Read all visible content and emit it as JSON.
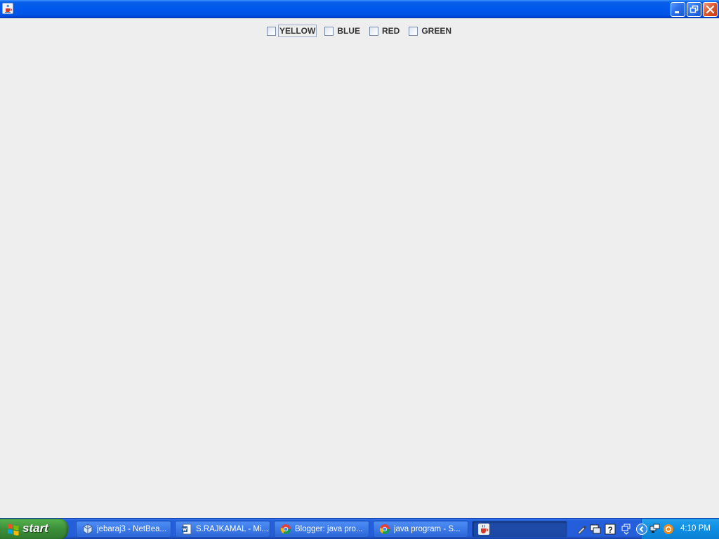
{
  "window": {
    "title": "",
    "icon": "java-cup-icon",
    "controls": [
      "minimize-icon",
      "restore-icon",
      "close-icon"
    ]
  },
  "checkboxes": [
    {
      "label": "YELLOW",
      "checked": false,
      "focused": true
    },
    {
      "label": "BLUE",
      "checked": false,
      "focused": false
    },
    {
      "label": "RED",
      "checked": false,
      "focused": false
    },
    {
      "label": "GREEN",
      "checked": false,
      "focused": false
    }
  ],
  "taskbar": {
    "start_label": "start",
    "tasks": [
      {
        "label": "jebaraj3 - NetBea...",
        "icon": "netbeans-cube-icon",
        "active": false
      },
      {
        "label": "S.RAJKAMAL - Mi...",
        "icon": "word-document-icon",
        "active": false
      },
      {
        "label": "Blogger: java pro...",
        "icon": "chrome-icon",
        "active": false
      },
      {
        "label": "java program - S...",
        "icon": "chrome-icon",
        "active": false
      },
      {
        "label": "",
        "icon": "java-cup-icon",
        "active": true
      }
    ],
    "quick_icons": [
      "pen-tool-icon",
      "network-monitor-icon",
      "help-icon",
      "windows-switch-icon"
    ],
    "tray": {
      "icons": [
        "expand-tray-icon",
        "network-icon",
        "browser-update-icon"
      ],
      "clock": "4:10 PM"
    }
  },
  "colors": {
    "titlebar": "#0054e3",
    "content_bg": "#eeeeee",
    "taskbar": "#245edb",
    "start_button": "#3c8e3a",
    "tray": "#0d8ee3"
  }
}
